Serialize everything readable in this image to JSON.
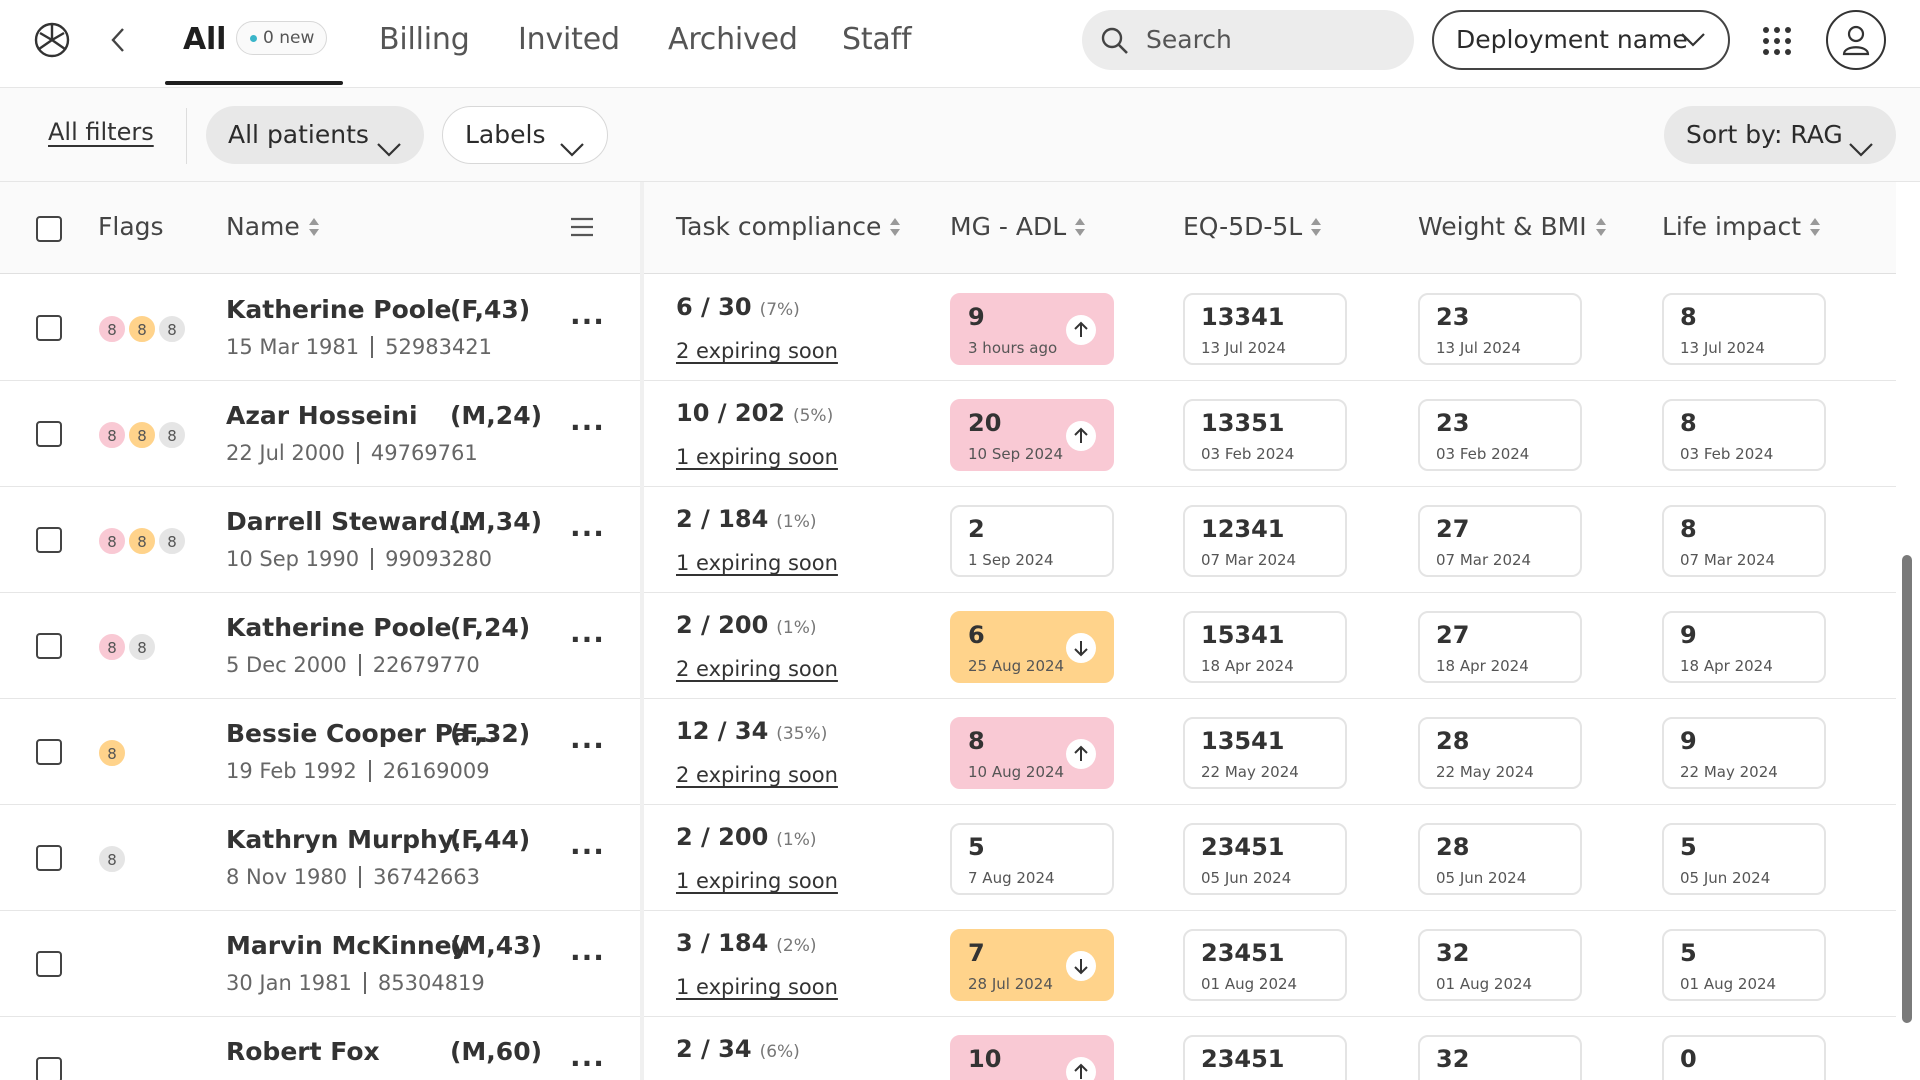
{
  "header": {
    "tabs": [
      {
        "label": "All",
        "active": true
      },
      {
        "label": "Billing"
      },
      {
        "label": "Invited"
      },
      {
        "label": "Archived"
      },
      {
        "label": "Staff"
      }
    ],
    "new_badge": "0 new",
    "search_placeholder": "Search",
    "deployment_label": "Deployment name"
  },
  "filters": {
    "all_filters": "All filters",
    "patients": "All patients",
    "labels": "Labels",
    "sort": "Sort by: RAG"
  },
  "table": {
    "columns": {
      "flags": "Flags",
      "name": "Name",
      "task": "Task compliance",
      "mg": "MG - ADL",
      "eq": "EQ-5D-5L",
      "weight": "Weight & BMI",
      "life": "Life impact"
    },
    "rows": [
      {
        "name": "Katherine Poole",
        "demo": "(F,43)",
        "dob": "15 Mar 1981",
        "id": "52983421",
        "flags": [
          {
            "n": "8",
            "c": "pink"
          },
          {
            "n": "8",
            "c": "amber"
          },
          {
            "n": "8",
            "c": "grey"
          }
        ],
        "task": "6 / 30",
        "pct": "(7%)",
        "expiring": "2 expiring soon",
        "mg": {
          "v": "9",
          "d": "3 hours ago",
          "status": "pink",
          "trend": "up"
        },
        "eq": {
          "v": "13341",
          "d": "13 Jul 2024"
        },
        "wb": {
          "v": "23",
          "d": "13 Jul 2024"
        },
        "li": {
          "v": "8",
          "d": "13 Jul 2024"
        }
      },
      {
        "name": "Azar Hosseini",
        "demo": "(M,24)",
        "dob": "22 Jul 2000",
        "id": "49769761",
        "flags": [
          {
            "n": "8",
            "c": "pink"
          },
          {
            "n": "8",
            "c": "amber"
          },
          {
            "n": "8",
            "c": "grey"
          }
        ],
        "task": "10 / 202",
        "pct": "(5%)",
        "expiring": "1 expiring soon",
        "mg": {
          "v": "20",
          "d": "10 Sep 2024",
          "status": "pink",
          "trend": "up"
        },
        "eq": {
          "v": "13351",
          "d": "03 Feb 2024"
        },
        "wb": {
          "v": "23",
          "d": "03 Feb 2024"
        },
        "li": {
          "v": "8",
          "d": "03 Feb 2024"
        }
      },
      {
        "name": "Darrell Steward...",
        "demo": "(M,34)",
        "dob": "10 Sep 1990",
        "id": "99093280",
        "flags": [
          {
            "n": "8",
            "c": "pink"
          },
          {
            "n": "8",
            "c": "amber"
          },
          {
            "n": "8",
            "c": "grey"
          }
        ],
        "task": "2 / 184",
        "pct": "(1%)",
        "expiring": "1 expiring soon",
        "mg": {
          "v": "2",
          "d": "1 Sep 2024",
          "status": "none",
          "trend": ""
        },
        "eq": {
          "v": "12341",
          "d": "07 Mar 2024"
        },
        "wb": {
          "v": "27",
          "d": "07 Mar 2024"
        },
        "li": {
          "v": "8",
          "d": "07 Mar 2024"
        }
      },
      {
        "name": "Katherine Poole",
        "demo": "(F,24)",
        "dob": "5 Dec 2000",
        "id": "22679770",
        "flags": [
          {
            "n": "8",
            "c": "pink"
          },
          {
            "n": "8",
            "c": "grey"
          }
        ],
        "task": "2 / 200",
        "pct": "(1%)",
        "expiring": "2 expiring soon",
        "mg": {
          "v": "6",
          "d": "25 Aug 2024",
          "status": "amber",
          "trend": "down"
        },
        "eq": {
          "v": "15341",
          "d": "18 Apr 2024"
        },
        "wb": {
          "v": "27",
          "d": "18 Apr 2024"
        },
        "li": {
          "v": "9",
          "d": "18 Apr 2024"
        }
      },
      {
        "name": "Bessie Cooper Pa...",
        "demo": "(F,32)",
        "dob": "19 Feb 1992",
        "id": "26169009",
        "flags": [
          {
            "n": "8",
            "c": "amber"
          }
        ],
        "task": "12 / 34",
        "pct": "(35%)",
        "expiring": "2 expiring soon",
        "mg": {
          "v": "8",
          "d": "10 Aug 2024",
          "status": "pink",
          "trend": "up"
        },
        "eq": {
          "v": "13541",
          "d": "22 May 2024"
        },
        "wb": {
          "v": "28",
          "d": "22 May 2024"
        },
        "li": {
          "v": "9",
          "d": "22 May 2024"
        }
      },
      {
        "name": "Kathryn Murphy...",
        "demo": "(F,44)",
        "dob": "8 Nov 1980",
        "id": "36742663",
        "flags": [
          {
            "n": "8",
            "c": "grey"
          }
        ],
        "task": "2 / 200",
        "pct": "(1%)",
        "expiring": "1 expiring soon",
        "mg": {
          "v": "5",
          "d": "7 Aug 2024",
          "status": "none",
          "trend": ""
        },
        "eq": {
          "v": "23451",
          "d": "05 Jun 2024"
        },
        "wb": {
          "v": "28",
          "d": "05 Jun 2024"
        },
        "li": {
          "v": "5",
          "d": "05 Jun 2024"
        }
      },
      {
        "name": "Marvin McKinney",
        "demo": "(M,43)",
        "dob": "30 Jan 1981",
        "id": "85304819",
        "flags": [],
        "task": "3 / 184",
        "pct": "(2%)",
        "expiring": "1 expiring soon",
        "mg": {
          "v": "7",
          "d": "28 Jul 2024",
          "status": "amber",
          "trend": "down"
        },
        "eq": {
          "v": "23451",
          "d": "01 Aug 2024"
        },
        "wb": {
          "v": "32",
          "d": "01 Aug 2024"
        },
        "li": {
          "v": "5",
          "d": "01 Aug 2024"
        }
      },
      {
        "name": "Robert Fox",
        "demo": "(M,60)",
        "dob": "",
        "id": "",
        "flags": [],
        "task": "2 / 34",
        "pct": "(6%)",
        "expiring": "",
        "mg": {
          "v": "10",
          "d": "",
          "status": "pink",
          "trend": "up"
        },
        "eq": {
          "v": "23451",
          "d": ""
        },
        "wb": {
          "v": "32",
          "d": ""
        },
        "li": {
          "v": "0",
          "d": ""
        }
      }
    ]
  },
  "colors": {
    "red_status": "#f9c9d4",
    "amber_status": "#ffd38b",
    "grey_flag": "#e5e5e5",
    "accent_dot": "#3ab5c9"
  },
  "icons": [
    "logo-icon",
    "back-chevron-icon",
    "search-icon",
    "chevron-down-icon",
    "apps-grid-icon",
    "user-icon",
    "sort-icon",
    "column-menu-icon",
    "more-icon",
    "arrow-up-icon",
    "arrow-down-icon"
  ]
}
